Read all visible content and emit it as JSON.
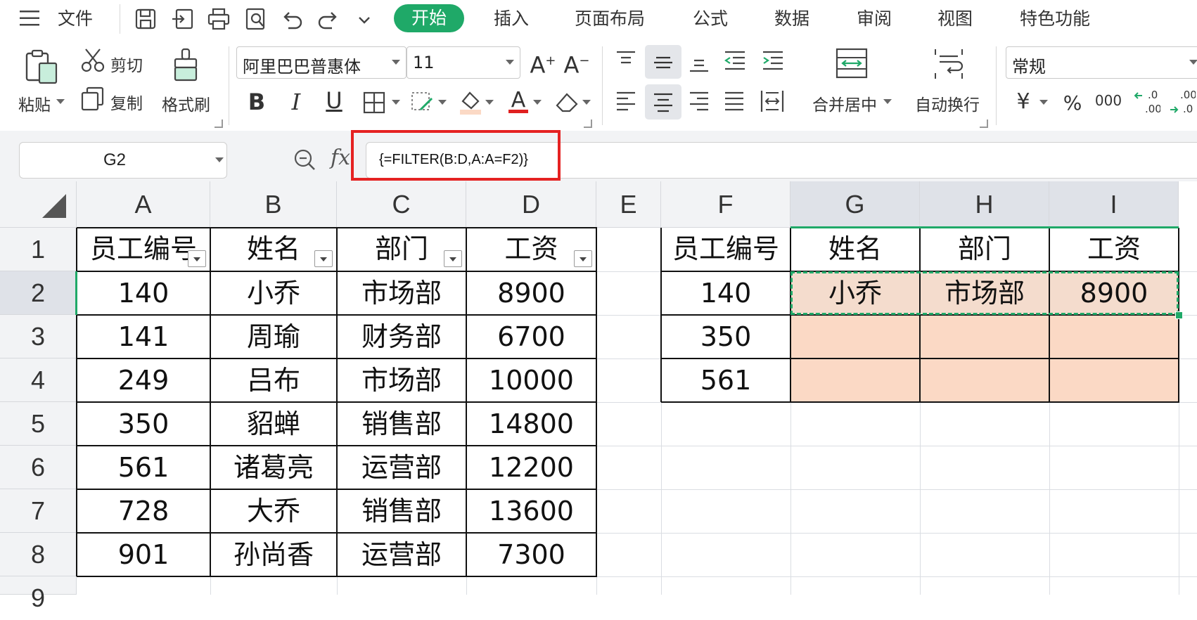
{
  "menu": {
    "file": "文件",
    "tabs": [
      "开始",
      "插入",
      "页面布局",
      "公式",
      "数据",
      "审阅",
      "视图",
      "特色功能"
    ]
  },
  "ribbon": {
    "paste": "粘贴",
    "cut": "剪切",
    "copy": "复制",
    "format_painter": "格式刷",
    "font_name": "阿里巴巴普惠体",
    "font_size": "11",
    "merge_center": "合并居中",
    "wrap_text": "自动换行",
    "number_format": "常规",
    "currency_symbol": "¥",
    "percent_symbol": "%",
    "thousands_symbol": "000"
  },
  "formula_bar": {
    "name_box": "G2",
    "fx": "fx",
    "formula": "{=FILTER(B:D,A:A=F2)}"
  },
  "columns": [
    "A",
    "B",
    "C",
    "D",
    "E",
    "F",
    "G",
    "H",
    "I"
  ],
  "rows": [
    "1",
    "2",
    "3",
    "4",
    "5",
    "6",
    "7",
    "8",
    "9"
  ],
  "left_table": {
    "headers": [
      "员工编号",
      "姓名",
      "部门",
      "工资"
    ],
    "rows": [
      [
        "140",
        "小乔",
        "市场部",
        "8900"
      ],
      [
        "141",
        "周瑜",
        "财务部",
        "6700"
      ],
      [
        "249",
        "吕布",
        "市场部",
        "10000"
      ],
      [
        "350",
        "貂蝉",
        "销售部",
        "14800"
      ],
      [
        "561",
        "诸葛亮",
        "运营部",
        "12200"
      ],
      [
        "728",
        "大乔",
        "销售部",
        "13600"
      ],
      [
        "901",
        "孙尚香",
        "运营部",
        "7300"
      ]
    ]
  },
  "right_table": {
    "headers": [
      "员工编号",
      "姓名",
      "部门",
      "工资"
    ],
    "rows": [
      [
        "140",
        "小乔",
        "市场部",
        "8900"
      ],
      [
        "350",
        "",
        "",
        ""
      ],
      [
        "561",
        "",
        "",
        ""
      ]
    ]
  },
  "colors": {
    "accent_green": "#1fa968",
    "highlight_fill": "#fbd9c5",
    "g2_fill": "#f4dccd",
    "red_frame": "#e52222"
  }
}
